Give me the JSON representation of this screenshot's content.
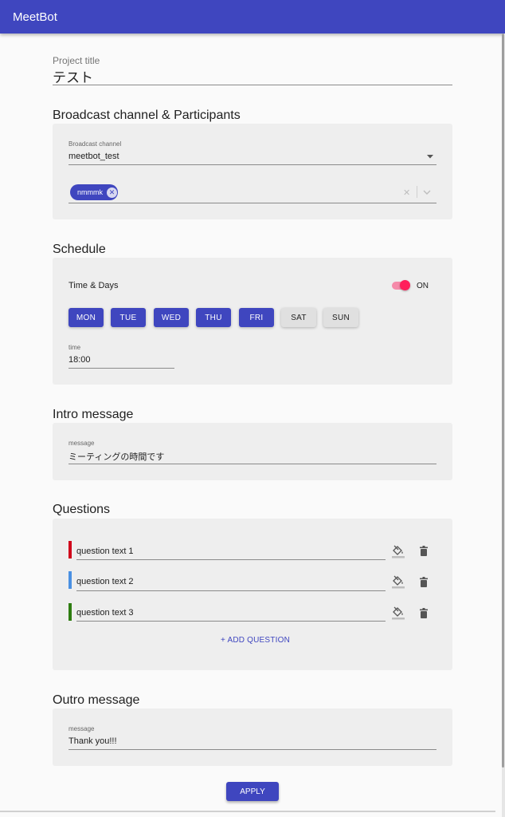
{
  "app": {
    "title": "MeetBot"
  },
  "project": {
    "label": "Project title",
    "value": "テスト"
  },
  "broadcast": {
    "section_title": "Broadcast channel & Participants",
    "channel_label": "Broadcast channel",
    "channel_value": "meetbot_test",
    "participants": [
      "nmmmk"
    ]
  },
  "schedule": {
    "section_title": "Schedule",
    "time_days_label": "Time & Days",
    "toggle_label": "ON",
    "toggle_on": true,
    "days": [
      {
        "label": "MON",
        "active": true
      },
      {
        "label": "TUE",
        "active": true
      },
      {
        "label": "WED",
        "active": true
      },
      {
        "label": "THU",
        "active": true
      },
      {
        "label": "FRI",
        "active": true
      },
      {
        "label": "SAT",
        "active": false
      },
      {
        "label": "SUN",
        "active": false
      }
    ],
    "time_label": "time",
    "time_value": "18:00"
  },
  "intro": {
    "section_title": "Intro message",
    "message_label": "message",
    "message_value": "ミーティングの時間です"
  },
  "questions": {
    "section_title": "Questions",
    "items": [
      {
        "text": "question text 1",
        "color": "#d0021b"
      },
      {
        "text": "question text 2",
        "color": "#4a90e2"
      },
      {
        "text": "question text 3",
        "color": "#2e7d11"
      }
    ],
    "add_label": "+ ADD QUESTION"
  },
  "outro": {
    "section_title": "Outro message",
    "message_label": "message",
    "message_value": "Thank you!!!"
  },
  "actions": {
    "apply_label": "APPLY"
  },
  "colors": {
    "primary": "#3f46bf",
    "accent": "#ff1f5b",
    "card_bg": "#eeeeee"
  }
}
